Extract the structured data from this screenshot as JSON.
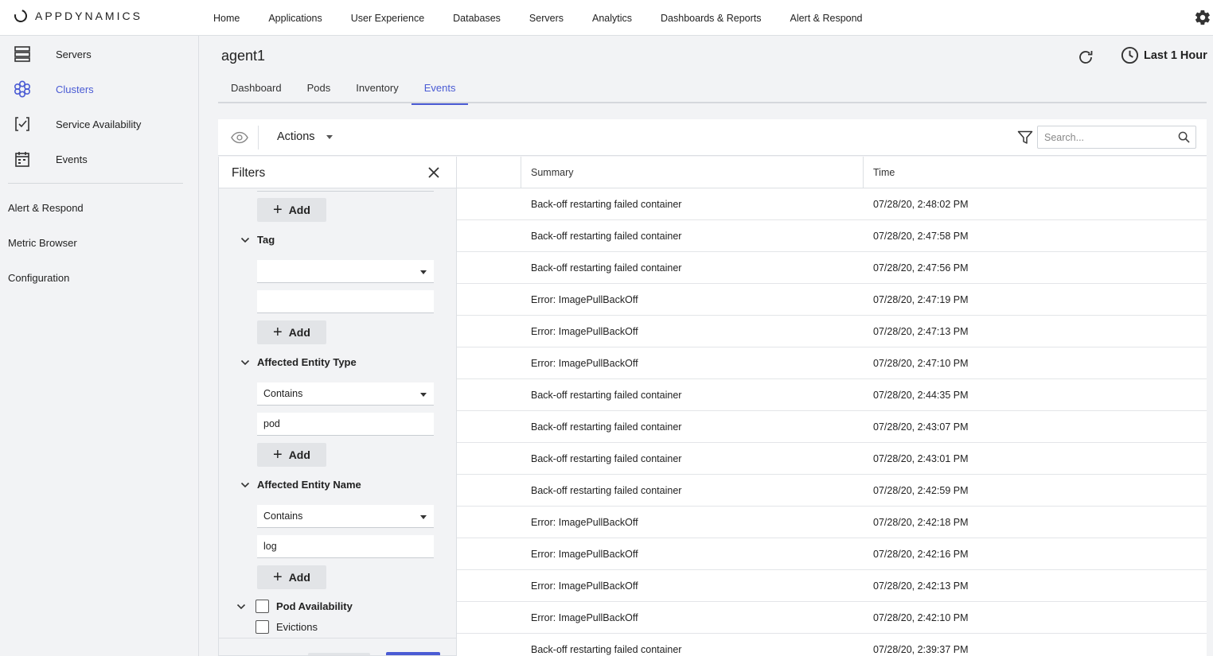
{
  "app": {
    "brand": "APPDYNAMICS"
  },
  "topnav": {
    "items": [
      "Home",
      "Applications",
      "User Experience",
      "Databases",
      "Servers",
      "Analytics",
      "Dashboards & Reports",
      "Alert & Respond"
    ]
  },
  "sidebar": {
    "items": [
      {
        "label": "Servers",
        "icon": "servers-icon"
      },
      {
        "label": "Clusters",
        "icon": "clusters-icon",
        "active": true
      },
      {
        "label": "Service Availability",
        "icon": "service-availability-icon"
      },
      {
        "label": "Events",
        "icon": "calendar-icon"
      }
    ],
    "links": [
      "Alert & Respond",
      "Metric Browser",
      "Configuration"
    ]
  },
  "page": {
    "title": "agent1",
    "time_range": "Last 1 Hour",
    "tabs": [
      "Dashboard",
      "Pods",
      "Inventory",
      "Events"
    ],
    "active_tab": "Events"
  },
  "toolbar": {
    "actions_label": "Actions",
    "search_placeholder": "Search..."
  },
  "filters": {
    "title": "Filters",
    "add_label": "Add",
    "sections": [
      {
        "label": "Tag",
        "operator": "",
        "value": ""
      },
      {
        "label": "Affected Entity Type",
        "operator": "Contains",
        "value": "pod"
      },
      {
        "label": "Affected Entity Name",
        "operator": "Contains",
        "value": "log"
      }
    ],
    "checkboxes": [
      {
        "label": "Pod Availability",
        "checked": false
      },
      {
        "label": "Evictions",
        "checked": false
      }
    ]
  },
  "table": {
    "columns": [
      "Summary",
      "Time"
    ],
    "rows": [
      {
        "summary": "Back-off restarting failed container",
        "time": "07/28/20, 2:48:02 PM"
      },
      {
        "summary": "Back-off restarting failed container",
        "time": "07/28/20, 2:47:58 PM"
      },
      {
        "summary": "Back-off restarting failed container",
        "time": "07/28/20, 2:47:56 PM"
      },
      {
        "summary": "Error: ImagePullBackOff",
        "time": "07/28/20, 2:47:19 PM"
      },
      {
        "summary": "Error: ImagePullBackOff",
        "time": "07/28/20, 2:47:13 PM"
      },
      {
        "summary": "Error: ImagePullBackOff",
        "time": "07/28/20, 2:47:10 PM"
      },
      {
        "summary": "Back-off restarting failed container",
        "time": "07/28/20, 2:44:35 PM"
      },
      {
        "summary": "Back-off restarting failed container",
        "time": "07/28/20, 2:43:07 PM"
      },
      {
        "summary": "Back-off restarting failed container",
        "time": "07/28/20, 2:43:01 PM"
      },
      {
        "summary": "Back-off restarting failed container",
        "time": "07/28/20, 2:42:59 PM"
      },
      {
        "summary": "Error: ImagePullBackOff",
        "time": "07/28/20, 2:42:18 PM"
      },
      {
        "summary": "Error: ImagePullBackOff",
        "time": "07/28/20, 2:42:16 PM"
      },
      {
        "summary": "Error: ImagePullBackOff",
        "time": "07/28/20, 2:42:13 PM"
      },
      {
        "summary": "Error: ImagePullBackOff",
        "time": "07/28/20, 2:42:10 PM"
      },
      {
        "summary": "Back-off restarting failed container",
        "time": "07/28/20, 2:39:37 PM"
      }
    ]
  },
  "colors": {
    "accent": "#4a5bd4",
    "background": "#f2f3f5"
  }
}
